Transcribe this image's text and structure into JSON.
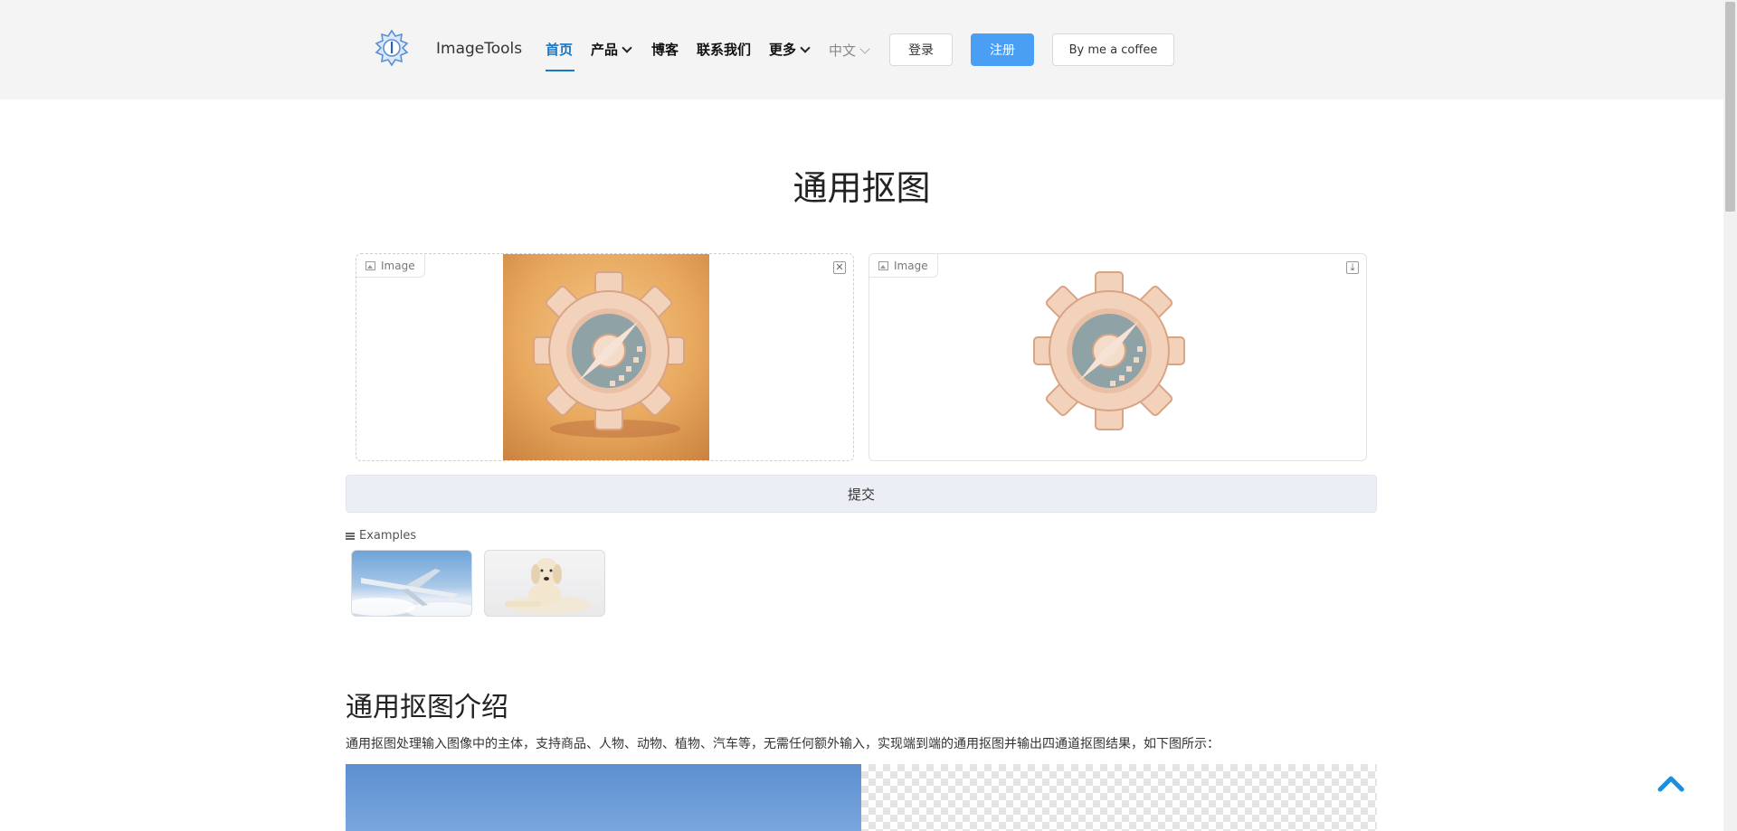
{
  "header": {
    "brand": "ImageTools",
    "nav": {
      "home": "首页",
      "products": "产品",
      "blog": "博客",
      "contact": "联系我们",
      "more": "更多",
      "language": "中文"
    },
    "login_label": "登录",
    "register_label": "注册",
    "coffee_label": "By me a coffee"
  },
  "main": {
    "title": "通用抠图",
    "input_panel": {
      "label": "Image",
      "action_icon": "close-icon"
    },
    "output_panel": {
      "label": "Image",
      "action_icon": "download-icon"
    },
    "submit_label": "提交",
    "examples_label": "Examples",
    "examples": [
      {
        "name": "airplane"
      },
      {
        "name": "dog"
      }
    ]
  },
  "intro": {
    "title": "通用抠图介绍",
    "description": "通用抠图处理输入图像中的主体，支持商品、人物、动物、植物、汽车等，无需任何额外输入，实现端到端的通用抠图并输出四通道抠图结果，如下图所示："
  },
  "colors": {
    "accent": "#1677c9",
    "register_button": "#4a9ff5",
    "back_to_top": "#1a8fe0"
  }
}
